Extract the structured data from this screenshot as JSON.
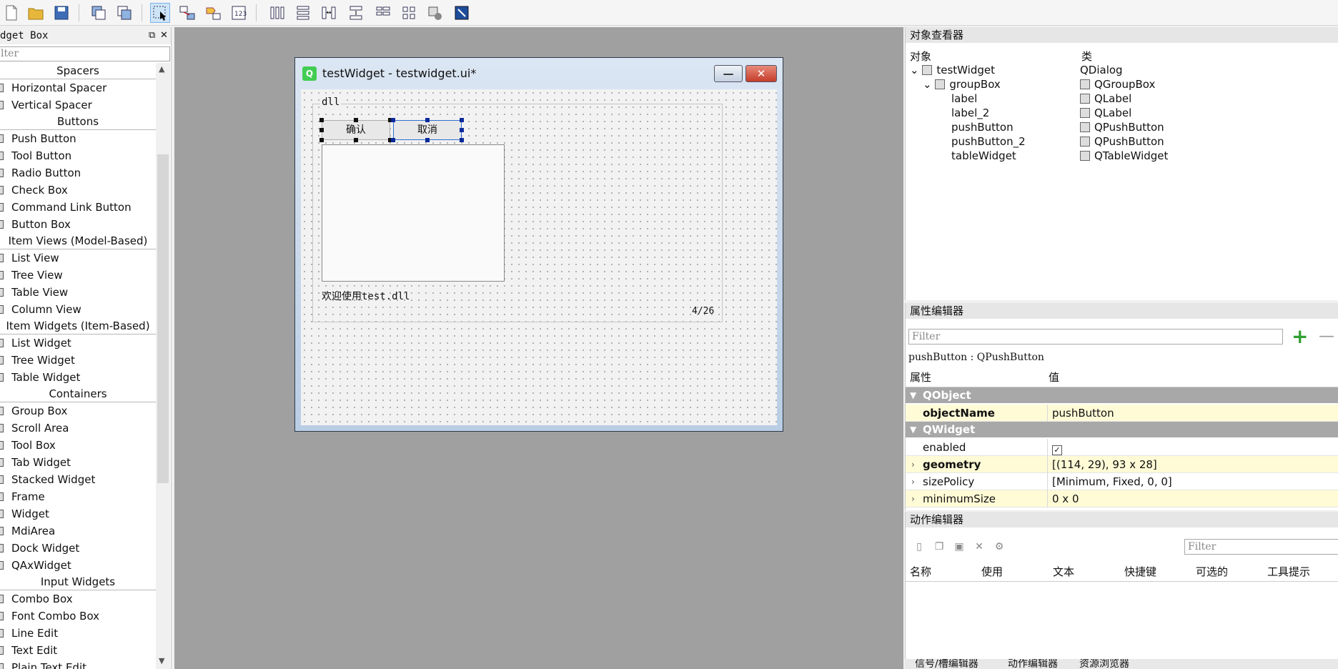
{
  "toolbar": {
    "tools": [
      "new-file-icon",
      "open-folder-icon",
      "save-icon",
      "send-to-back-icon",
      "bring-to-front-icon",
      "edit-widgets-icon",
      "edit-signals-slots-icon",
      "edit-buddies-icon",
      "edit-tab-order-icon",
      "layout-horizontal-icon",
      "layout-vertical-icon",
      "layout-h-splitter-icon",
      "layout-v-splitter-icon",
      "layout-form-icon",
      "layout-grid-icon",
      "break-layout-icon",
      "adjust-size-icon"
    ]
  },
  "widget_box": {
    "title": "dget Box",
    "filter_placeholder": "lter",
    "sections": [
      {
        "label": "Spacers",
        "items": [
          "Horizontal Spacer",
          "Vertical Spacer"
        ]
      },
      {
        "label": "Buttons",
        "items": [
          "Push Button",
          "Tool Button",
          "Radio Button",
          "Check Box",
          "Command Link Button",
          "Button Box"
        ]
      },
      {
        "label": "Item Views (Model-Based)",
        "items": [
          "List View",
          "Tree View",
          "Table View",
          "Column View"
        ]
      },
      {
        "label": "Item Widgets (Item-Based)",
        "items": [
          "List Widget",
          "Tree Widget",
          "Table Widget"
        ]
      },
      {
        "label": "Containers",
        "items": [
          "Group Box",
          "Scroll Area",
          "Tool Box",
          "Tab Widget",
          "Stacked Widget",
          "Frame",
          "Widget",
          "MdiArea",
          "Dock Widget",
          "QAxWidget"
        ]
      },
      {
        "label": "Input Widgets",
        "items": [
          "Combo Box",
          "Font Combo Box",
          "Line Edit",
          "Text Edit",
          "Plain Text Edit"
        ]
      }
    ]
  },
  "form": {
    "window_title": "testWidget - testwidget.ui*",
    "groupbox_title": "dll",
    "button_confirm": "确认",
    "button_cancel": "取消",
    "label_welcome": "欢迎使用test.dll",
    "label_count": "4/26"
  },
  "object_inspector": {
    "title": "对象查看器",
    "col_object": "对象",
    "col_class": "类",
    "rows": [
      {
        "name": "testWidget",
        "cls": "QDialog"
      },
      {
        "name": "groupBox",
        "cls": "QGroupBox"
      },
      {
        "name": "label",
        "cls": "QLabel"
      },
      {
        "name": "label_2",
        "cls": "QLabel"
      },
      {
        "name": "pushButton",
        "cls": "QPushButton"
      },
      {
        "name": "pushButton_2",
        "cls": "QPushButton"
      },
      {
        "name": "tableWidget",
        "cls": "QTableWidget"
      }
    ]
  },
  "property_editor": {
    "title": "属性编辑器",
    "filter_placeholder": "Filter",
    "selected": "pushButton : QPushButton",
    "col_property": "属性",
    "col_value": "值",
    "group_qobject": "QObject",
    "group_qwidget": "QWidget",
    "object_name_key": "objectName",
    "object_name_value": "pushButton",
    "enabled_key": "enabled",
    "geometry_key": "geometry",
    "geometry_value": "[(114, 29), 93 x 28]",
    "size_policy_key": "sizePolicy",
    "size_policy_value": "[Minimum, Fixed, 0, 0]",
    "min_size_key": "minimumSize",
    "min_size_value": "0 x 0"
  },
  "action_editor": {
    "title": "动作编辑器",
    "filter_placeholder": "Filter",
    "columns": [
      "名称",
      "使用",
      "文本",
      "快捷键",
      "可选的",
      "工具提示"
    ]
  },
  "bottom_tabs": [
    "信号/槽编辑器",
    "动作编辑器",
    "资源浏览器"
  ],
  "colors": {
    "selection": "#cde4f7",
    "highlight_row": "#fffbd6",
    "group_header": "#a8a8a8",
    "mdi_background": "#a0a0a0"
  }
}
